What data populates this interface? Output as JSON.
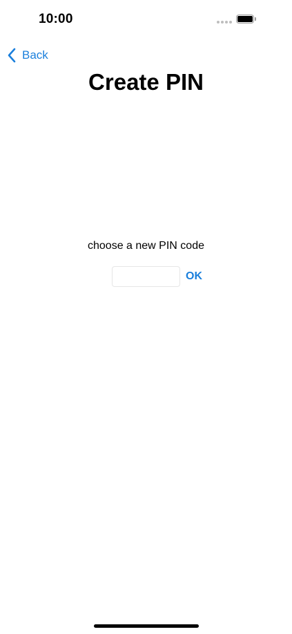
{
  "status_bar": {
    "time": "10:00",
    "battery_level": 1.0
  },
  "nav": {
    "back_label": "Back",
    "back_icon": "chevron-left-icon"
  },
  "page": {
    "title": "Create PIN"
  },
  "form": {
    "prompt": "choose a new PIN code",
    "pin_value": "",
    "ok_label": "OK"
  },
  "colors": {
    "accent": "#1a7fdc",
    "background": "#ffffff",
    "text": "#000000"
  }
}
